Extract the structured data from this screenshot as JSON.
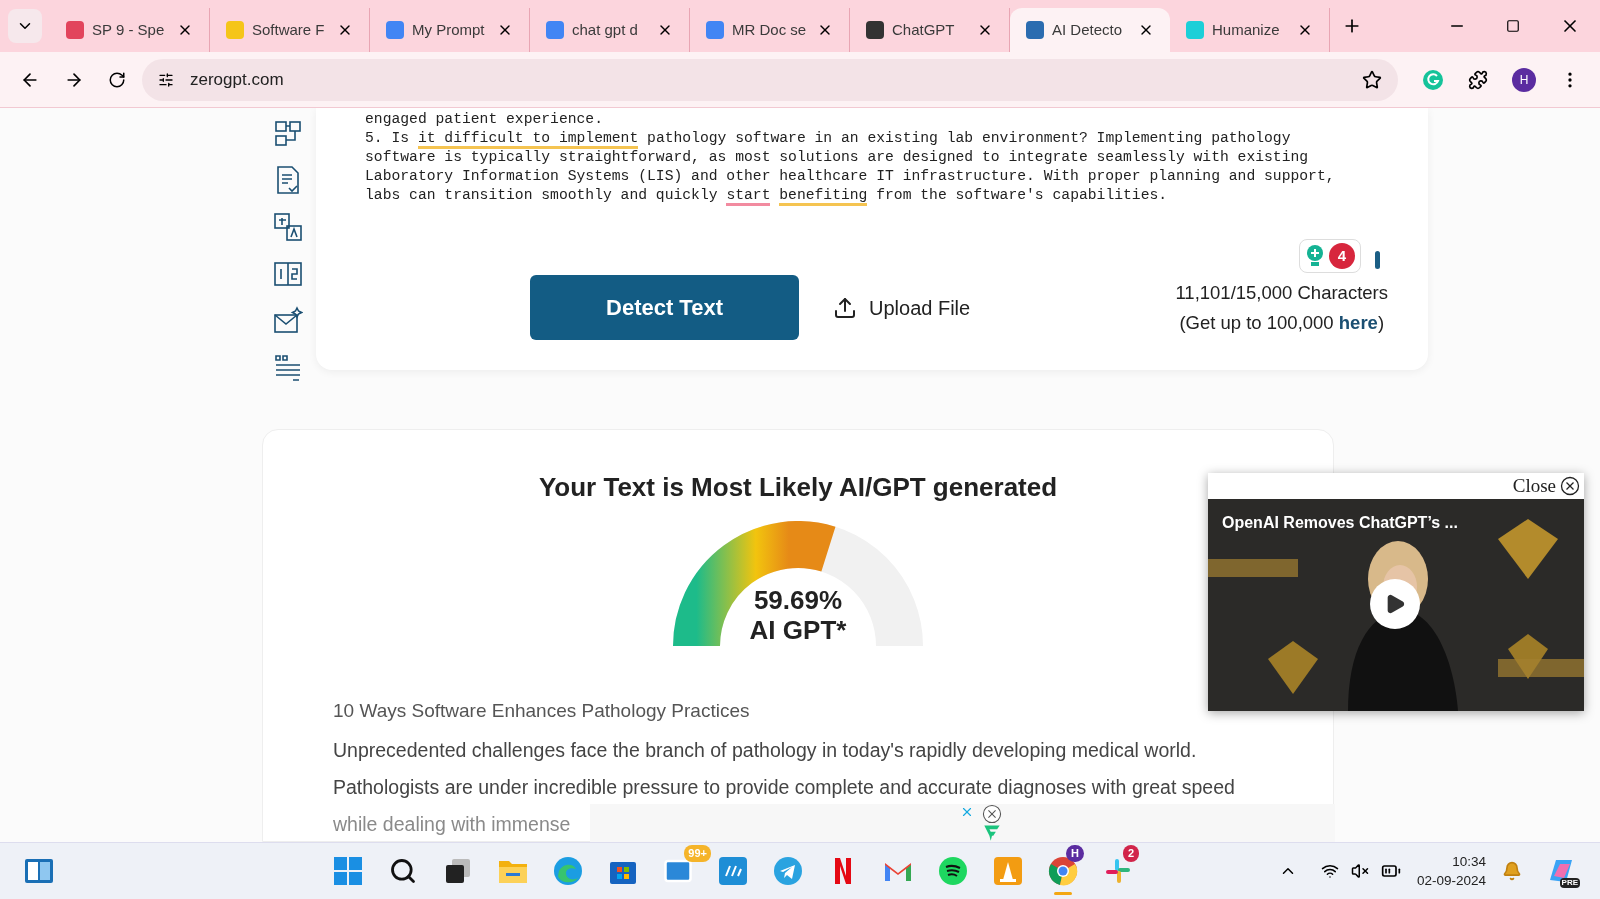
{
  "tabs": [
    {
      "title": "SP 9 - Spe",
      "selected": false,
      "color": "#e2445c"
    },
    {
      "title": "Software F",
      "selected": false,
      "color": "#f5c518"
    },
    {
      "title": "My Prompt",
      "selected": false,
      "color": "#4285f4"
    },
    {
      "title": "chat gpt d",
      "selected": false,
      "color": "#4285f4"
    },
    {
      "title": "MR Doc se",
      "selected": false,
      "color": "#4285f4"
    },
    {
      "title": "ChatGPT",
      "selected": false,
      "color": "#333333"
    },
    {
      "title": "AI Detecto",
      "selected": true,
      "color": "#2b6cb0"
    },
    {
      "title": "Humanize",
      "selected": false,
      "color": "#1ccfd8"
    }
  ],
  "address": "zerogpt.com",
  "profile_initial": "H",
  "editor": {
    "lines": [
      [
        {
          "text": "engaged patient experience.",
          "kind": "plain"
        }
      ],
      [
        {
          "text": "5. Is ",
          "kind": "plain"
        },
        {
          "text": "it difficult to implement",
          "kind": "grammar"
        },
        {
          "text": " pathology software in an existing lab environment? Implementing pathology",
          "kind": "plain"
        }
      ],
      [
        {
          "text": "software is typically straightforward, as most solutions are designed to integrate seamlessly with existing",
          "kind": "plain"
        }
      ],
      [
        {
          "text": "Laboratory Information Systems (LIS) and other healthcare IT infrastructure. With proper planning and support,",
          "kind": "plain"
        }
      ],
      [
        {
          "text": "labs can transition smoothly and quickly ",
          "kind": "plain"
        },
        {
          "text": "start",
          "kind": "spelling"
        },
        {
          "text": "benefiting",
          "kind": "grammar"
        },
        {
          "text": " from the software's capabilities.",
          "kind": "plain"
        }
      ]
    ],
    "suggestion_count": "4"
  },
  "detect_button": "Detect Text",
  "upload_button": "Upload File",
  "char_count": "11,101/15,000 Characters",
  "upgrade": {
    "before": "(Get up to 100,000 ",
    "link": "here",
    "after": ")"
  },
  "result": {
    "title": "Your Text is Most Likely AI/GPT generated",
    "percent": "59.69%",
    "label": "AI GPT*"
  },
  "article": {
    "heading": "10 Ways Software Enhances Pathology Practices",
    "paragraphs": [
      "Unprecedented challenges face the branch of pathology in today's rapidly developing medical world.",
      "Pathologists are under incredible pressure to provide complete and accurate diagnoses with great speed",
      "while dealing with immense"
    ]
  },
  "video": {
    "close": "Close",
    "title": "OpenAI Removes ChatGPT’s ..."
  },
  "taskbar": {
    "apps": [
      {
        "kind": "start",
        "active": false
      },
      {
        "kind": "search",
        "active": false
      },
      {
        "kind": "taskview",
        "active": false
      },
      {
        "kind": "files",
        "active": false
      },
      {
        "kind": "edge",
        "active": false
      },
      {
        "kind": "store",
        "active": false
      },
      {
        "kind": "mail",
        "badge": "99+",
        "active": false
      },
      {
        "kind": "hp",
        "active": false
      },
      {
        "kind": "telegram",
        "active": false
      },
      {
        "kind": "netflix",
        "active": false
      },
      {
        "kind": "gmail",
        "active": false
      },
      {
        "kind": "spotify",
        "active": false
      },
      {
        "kind": "vlc",
        "active": false
      },
      {
        "kind": "chrome",
        "badge": "H",
        "active": true
      },
      {
        "kind": "slack",
        "badge": "2",
        "active": false
      }
    ],
    "time": "10:34",
    "date": "02-09-2024",
    "copilot_tag": "PRE"
  }
}
